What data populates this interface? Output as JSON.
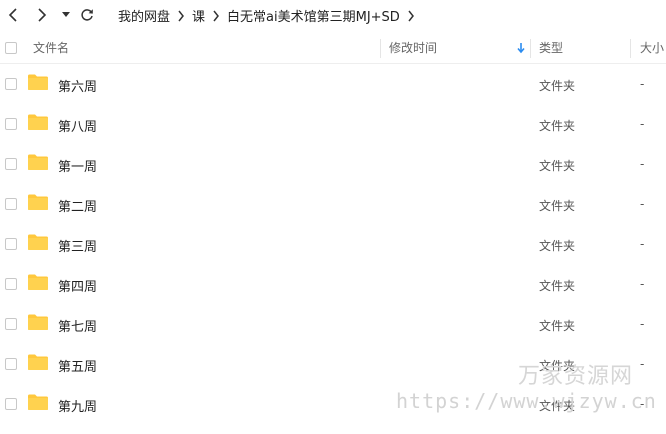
{
  "breadcrumb": [
    "我的网盘",
    "课",
    "白无常ai美术馆第三期MJ+SD"
  ],
  "columns": {
    "name": "文件名",
    "modified": "修改时间",
    "type": "类型",
    "size": "大小"
  },
  "rows": [
    {
      "name": "第六周",
      "type": "文件夹",
      "size": "-"
    },
    {
      "name": "第八周",
      "type": "文件夹",
      "size": "-"
    },
    {
      "name": "第一周",
      "type": "文件夹",
      "size": "-"
    },
    {
      "name": "第二周",
      "type": "文件夹",
      "size": "-"
    },
    {
      "name": "第三周",
      "type": "文件夹",
      "size": "-"
    },
    {
      "name": "第四周",
      "type": "文件夹",
      "size": "-"
    },
    {
      "name": "第七周",
      "type": "文件夹",
      "size": "-"
    },
    {
      "name": "第五周",
      "type": "文件夹",
      "size": "-"
    },
    {
      "name": "第九周",
      "type": "文件夹",
      "size": "-"
    }
  ],
  "watermark": {
    "title": "万家资源网",
    "url": "https://www.wjzyw.cn"
  },
  "colors": {
    "folder": "#FFC83D",
    "sort_arrow": "#2B8CF0"
  },
  "icons": {
    "back": "chevron-left-icon",
    "forward": "chevron-right-icon",
    "history": "caret-down-icon",
    "refresh": "refresh-icon",
    "folder": "folder-icon",
    "sort": "arrow-down-icon"
  }
}
